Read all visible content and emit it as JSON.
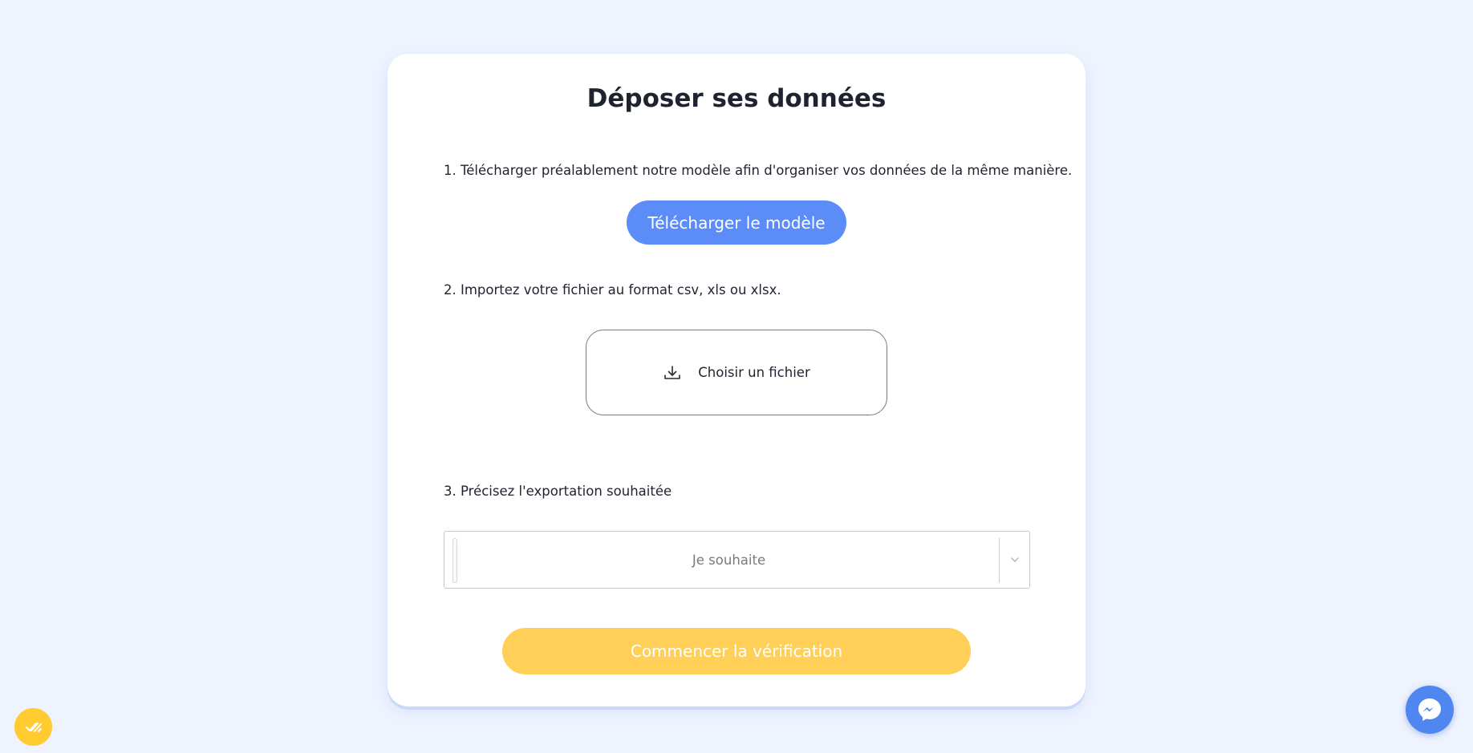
{
  "page": {
    "title": "Déposer ses données"
  },
  "steps": {
    "step1_text": "1. Télécharger préalablement notre modèle afin d'organiser vos données de la même manière.",
    "step2_text": "2. Importez votre fichier au format csv, xls ou xlsx.",
    "step3_text": "3. Précisez l'exportation souhaitée"
  },
  "buttons": {
    "download_template_label": "Télécharger le modèle",
    "choose_file_label": "Choisir un fichier",
    "start_verification_label": "Commencer la vérification"
  },
  "export_select": {
    "placeholder": "Je souhaite"
  },
  "icons": {
    "choose_file": "download-icon",
    "select_chevron": "chevron-down-icon",
    "left_fab": "checkmarks-icon",
    "right_fab": "messenger-icon"
  },
  "colors": {
    "background": "#eef3fe",
    "primary": "#5b8cf7",
    "accent_yellow": "#ffcf57",
    "messenger_blue": "#4f86f0"
  }
}
